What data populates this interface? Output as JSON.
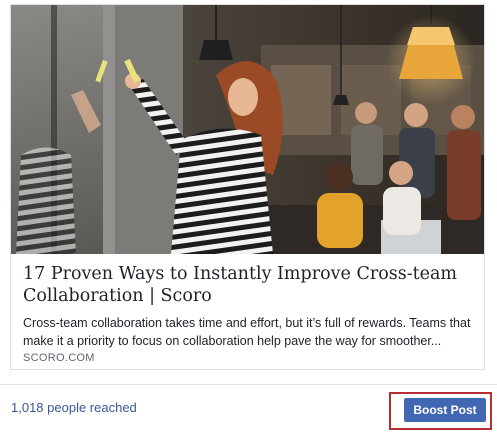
{
  "link_preview": {
    "image_icon": "office-brainstorm-photo",
    "headline": "17 Proven Ways to Instantly Improve Cross-team Collaboration | Scoro",
    "description_lines": [
      "Cross-team collaboration takes time and effort, but it’s full of rewards. Teams that",
      "make it a priority to focus on collaboration help pave the way for smoother..."
    ],
    "domain": "SCORO.COM"
  },
  "footer": {
    "reach_text": "1,018 people reached",
    "boost_button_label": "Boost Post"
  },
  "colors": {
    "link_blue": "#385898",
    "button_blue": "#4267b2",
    "highlight_red": "#b42e33",
    "text_dark": "#1d2129",
    "text_muted": "#606770",
    "border": "#dddfe2"
  }
}
